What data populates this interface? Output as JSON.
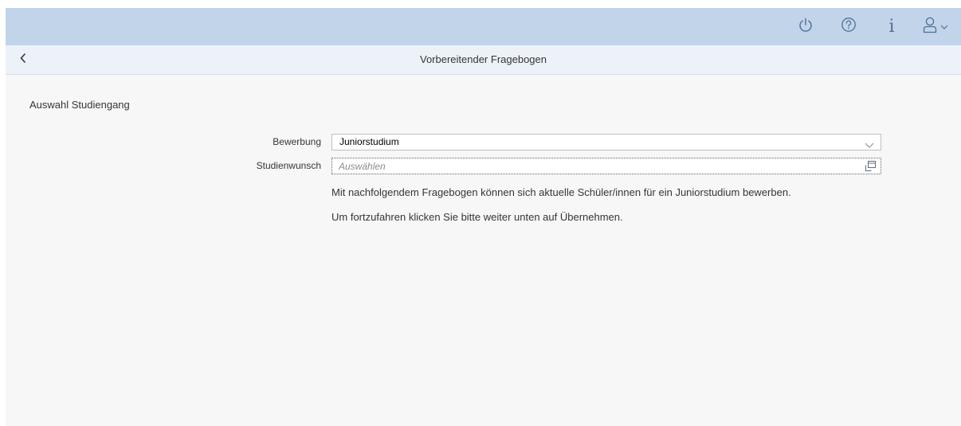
{
  "shellbar": {
    "icons": [
      "power-icon",
      "help-icon",
      "info-icon",
      "user-icon",
      "chevron-down-icon"
    ],
    "info_glyph": "i",
    "accent_color": "#4f6e95",
    "background_color": "#c2d4ea"
  },
  "subheader": {
    "title": "Vorbereitender Fragebogen",
    "back_icon": "chevron-left-icon"
  },
  "form": {
    "section_title": "Auswahl Studiengang",
    "bewerbung": {
      "label": "Bewerbung",
      "selected_value": "Juniorstudium"
    },
    "studienwunsch": {
      "label": "Studienwunsch",
      "value": "",
      "placeholder": "Auswählen"
    },
    "info_lines": [
      "Mit nachfolgendem Fragebogen können sich aktuelle Schüler/innen für ein Juniorstudium bewerben.",
      "Um fortzufahren klicken Sie bitte weiter unten auf Übernehmen."
    ]
  }
}
